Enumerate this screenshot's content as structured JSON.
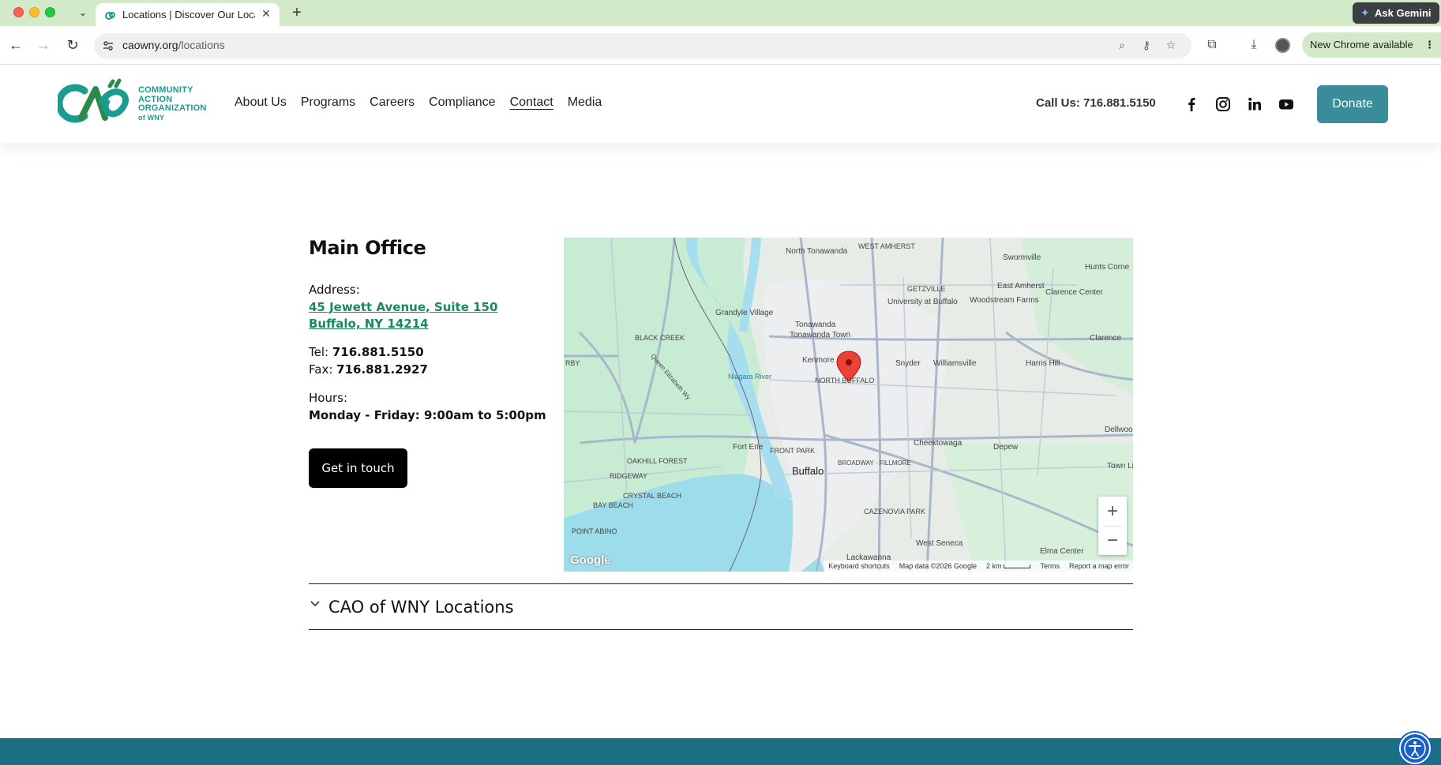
{
  "browser": {
    "tab_title": "Locations | Discover Our Loca",
    "url_host": "caowny.org",
    "url_path": "/locations",
    "ask_gemini": "Ask Gemini",
    "new_chrome": "New Chrome available"
  },
  "header": {
    "logo_lines": [
      "COMMUNITY",
      "ACTION",
      "ORGANIZATION",
      "of WNY"
    ],
    "nav": [
      "About Us",
      "Programs",
      "Careers",
      "Compliance",
      "Contact",
      "Media"
    ],
    "active_nav": "Contact",
    "call_us": "Call Us: 716.881.5150",
    "social": [
      "facebook-icon",
      "instagram-icon",
      "linkedin-icon",
      "youtube-icon"
    ],
    "donate": "Donate",
    "accent_color": "#3b8c9a",
    "brand_color": "#1c9c8f"
  },
  "office": {
    "title": "Main Office",
    "address_label": "Address:",
    "address_line1": "45 Jewett Avenue, Suite 150",
    "address_line2": "Buffalo, NY 14214",
    "tel_label": "Tel:",
    "tel": "716.881.5150",
    "fax_label": "Fax:",
    "fax": "716.881.2927",
    "hours_label": "Hours:",
    "hours": "Monday - Friday: 9:00am to 5:00pm",
    "cta": "Get in touch"
  },
  "map": {
    "places": [
      "North Tonawanda",
      "WEST AMHERST",
      "Swormville",
      "Hunts Corne",
      "GETZVILLE",
      "East Amherst",
      "Grandyle Village",
      "Tonawanda",
      "University at Buffalo",
      "Woodstream Farms",
      "Clarence Center",
      "Tonawanda Town",
      "BLACK CREEK",
      "Kenmore",
      "Snyder",
      "Williamsville",
      "Harris Hill",
      "Clarence",
      "RBY",
      "NORTH BUFFALO",
      "Niagara River",
      "Cheektowaga",
      "Depew",
      "Dellwoo",
      "OAKHILL FOREST",
      "Fort Erie",
      "FRONT PARK",
      "Buffalo",
      "BROADWAY - FILLMORE",
      "Town Li",
      "RIDGEWAY",
      "CRYSTAL BEACH",
      "BAY BEACH",
      "CAZENOVIA PARK",
      "POINT ABINO",
      "West Seneca",
      "Lackawanna",
      "Elma Center",
      "Queen Elizabeth Wy"
    ],
    "google": "Google",
    "keyboard_shortcuts": "Keyboard shortcuts",
    "map_data": "Map data ©2026 Google",
    "scale": "2 km",
    "terms": "Terms",
    "report": "Report a map error",
    "zoom_in": "+",
    "zoom_out": "−"
  },
  "accordion": {
    "title": "CAO of WNY Locations"
  }
}
